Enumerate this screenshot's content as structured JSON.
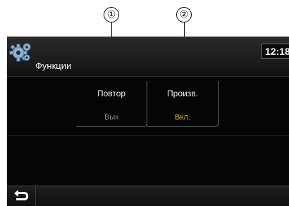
{
  "callouts": [
    {
      "label": "①"
    },
    {
      "label": "②"
    }
  ],
  "header": {
    "title": "Функции",
    "clock": "12:18",
    "icon": "gear-icon"
  },
  "options": [
    {
      "label": "Повтор",
      "value": "Вык",
      "value_color": "#8a8a8a"
    },
    {
      "label": "Произв.",
      "value": "Вкл.",
      "value_color": "#f0b428"
    }
  ],
  "footer": {
    "back_icon": "back-arrow-icon"
  },
  "colors": {
    "screen_bg": "#050505",
    "accent_on": "#f0b428",
    "muted_off": "#8a8a8a"
  }
}
